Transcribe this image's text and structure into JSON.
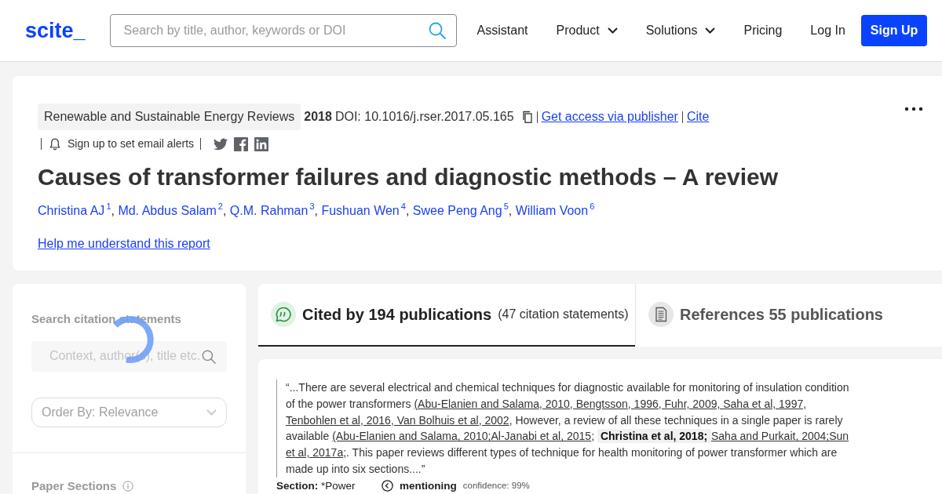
{
  "header": {
    "logo": "scite_",
    "search": {
      "placeholder": "Search by title, author, keywords or DOI"
    },
    "nav": [
      {
        "label": "Assistant",
        "kind": "link"
      },
      {
        "label": "Product",
        "kind": "dropdown"
      },
      {
        "label": "Solutions",
        "kind": "dropdown"
      },
      {
        "label": "Pricing",
        "kind": "link"
      },
      {
        "label": "Log In",
        "kind": "link"
      },
      {
        "label": "Sign Up",
        "kind": "button"
      }
    ]
  },
  "paper": {
    "journal": "Renewable and Sustainable Energy Reviews",
    "year": "2018",
    "doi": "DOI: 10.1016/j.rser.2017.05.165",
    "links": [
      "Get access via publisher",
      "Cite"
    ],
    "alerts": "Sign up to set email alerts",
    "title": "Causes of transformer failures and diagnostic methods – A review",
    "authors": [
      {
        "name": "Christina AJ",
        "affiliation": "1",
        "separator": ","
      },
      {
        "name": "Md. Abdus Salam",
        "affiliation": "2",
        "separator": ","
      },
      {
        "name": "Q.M. Rahman",
        "affiliation": "3",
        "separator": ","
      },
      {
        "name": "Fushuan Wen",
        "affiliation": "4",
        "separator": ","
      },
      {
        "name": "Swee Peng Ang",
        "affiliation": "5",
        "separator": ","
      },
      {
        "name": "William Voon",
        "affiliation": "6"
      }
    ],
    "help_link": "Help me understand this report"
  },
  "citation_search": {
    "loading": true,
    "heading": "Search citation statements",
    "search": {
      "placeholder": "Context, author(s), title etc."
    },
    "order_by": "Order By: Relevance",
    "sections_heading": "Paper Sections"
  },
  "tabs": [
    {
      "kind": "cited",
      "label": "Cited by 194 publications",
      "note": "(47 citation statements)",
      "selected": true
    },
    {
      "kind": "references",
      "label": "References 55 publications",
      "selected": false
    }
  ],
  "citations": [
    {
      "quote": [
        {
          "kind": "text",
          "text": "“...There are several electrical and chemical techniques for diagnostic available for monitoring of insulation condition of the power transformers "
        },
        {
          "kind": "citation",
          "text": "(Abu-Elanien and Salama, 2010, Bengtsson, 1996, Fuhr, 2009, Saha et al, 1997, Tenbohlen et al, 2016, Van Bolhuis et al, 2002"
        },
        {
          "kind": "text",
          "text": ", However, a review of all these techniques in a single paper is rarely available "
        },
        {
          "kind": "citation",
          "text": "(Abu-Elanien and Salama, 2010;Al-Janabi et al, 2015"
        },
        {
          "kind": "text",
          "text": "; "
        },
        {
          "kind": "self",
          "text": "Christina et al, 2018; "
        },
        {
          "kind": "citation",
          "text": "Saha and Purkait, 2004;Sun et al, 2017a;"
        },
        {
          "kind": "text",
          "text": ". This paper reviews different types of technique for health monitoring of power transformer which are made up into six sections....”"
        }
      ],
      "section_label": "Section:",
      "section": "*Power",
      "classification": "mentioning",
      "confidence": "confidence: 99%"
    }
  ]
}
